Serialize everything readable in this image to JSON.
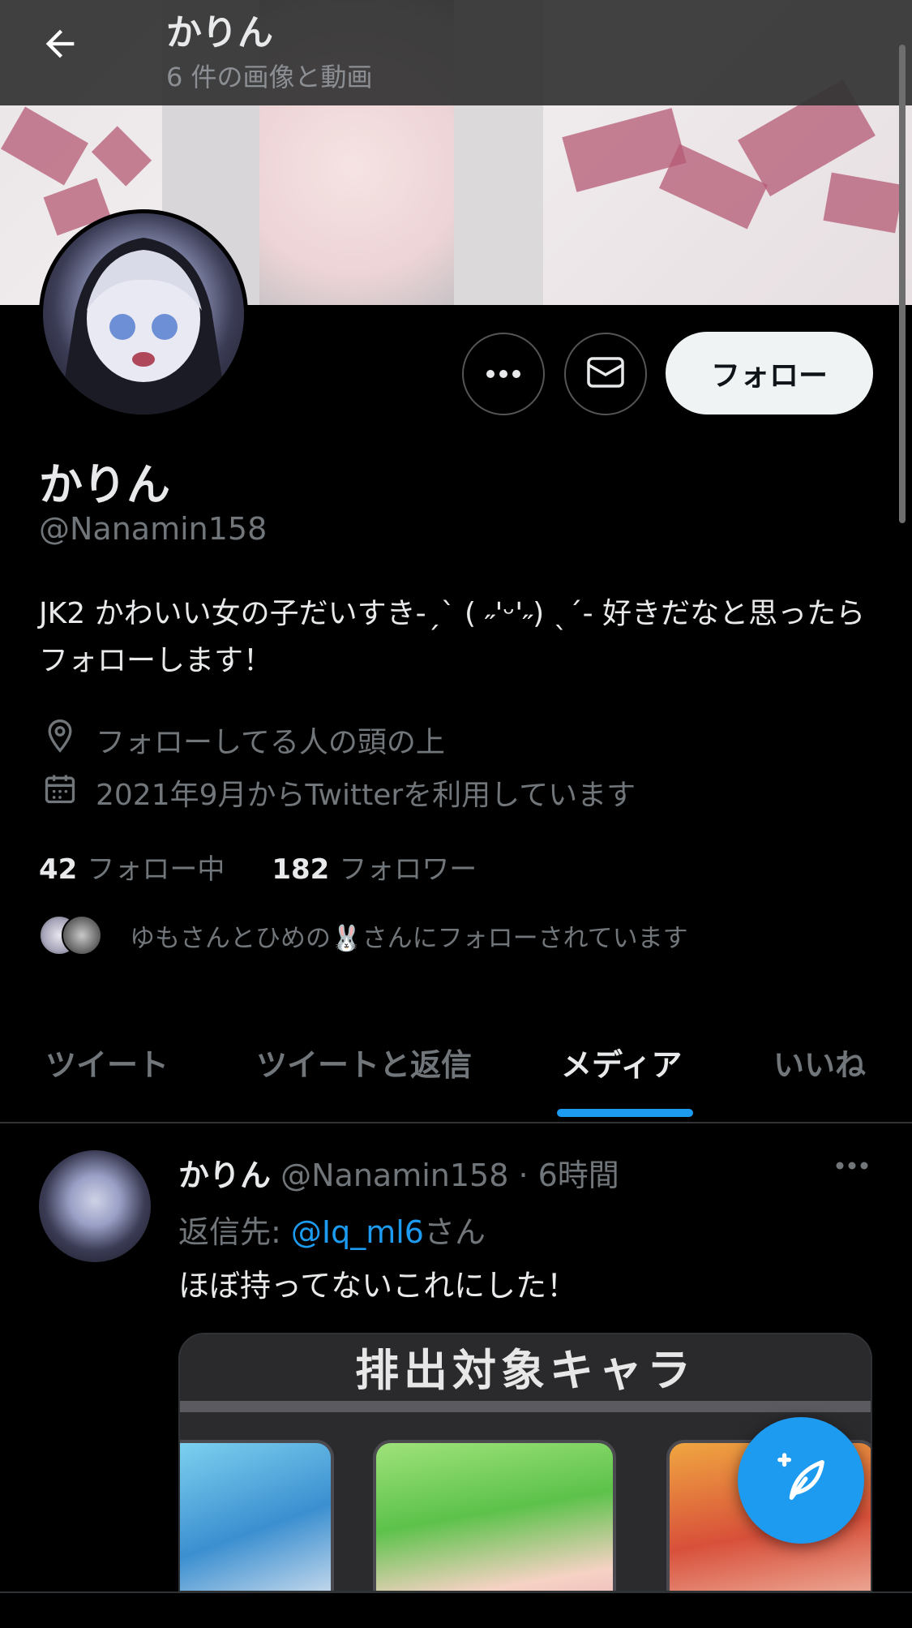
{
  "header": {
    "name": "かりん",
    "subtitle": "6 件の画像と動画"
  },
  "profile": {
    "name": "かりん",
    "handle": "@Nanamin158",
    "follow_label": "フォロー",
    "bio": "JK2 かわいい女の子だいすき-ˏˋ ( ˶'ᵕ'˶) ˎˊ- 好きだなと思ったらフォローします！",
    "location": "フォローしてる人の頭の上",
    "joined": "2021年9月からTwitterを利用しています",
    "following_count": "42",
    "following_label": "フォロー中",
    "followers_count": "182",
    "followers_label": "フォロワー",
    "followed_by": "ゆもさんとひめの🐰さんにフォローされています"
  },
  "tabs": [
    {
      "label": "ツイート"
    },
    {
      "label": "ツイートと返信"
    },
    {
      "label": "メディア"
    },
    {
      "label": "いいね"
    }
  ],
  "active_tab": "メディア",
  "tweet": {
    "name": "かりん",
    "meta": "@Nanamin158 · 6時間",
    "reply_prefix": "返信先: ",
    "reply_handle": "@Iq_ml6",
    "reply_suffix": "さん",
    "text": "ほぼ持ってないこれにした！",
    "media_title": "排出対象キャラ"
  },
  "colors": {
    "accent": "#1d9bf0",
    "background": "#000000",
    "muted_text": "#71767b"
  }
}
